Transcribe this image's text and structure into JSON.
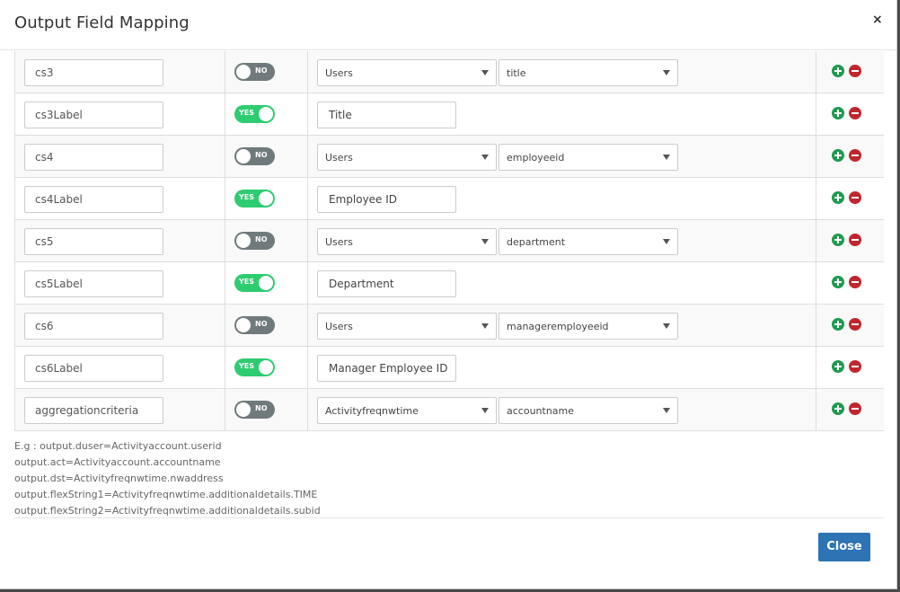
{
  "dialog": {
    "title": "Output Field Mapping",
    "close_icon": "×",
    "close_button_label": "Close"
  },
  "rows": [
    {
      "field": "cs3",
      "toggle": "NO",
      "toggle_on": false,
      "source": "Users",
      "attribute": "title"
    },
    {
      "field": "cs3Label",
      "toggle": "YES",
      "toggle_on": true,
      "label_value": "Title"
    },
    {
      "field": "cs4",
      "toggle": "NO",
      "toggle_on": false,
      "source": "Users",
      "attribute": "employeeid"
    },
    {
      "field": "cs4Label",
      "toggle": "YES",
      "toggle_on": true,
      "label_value": "Employee ID"
    },
    {
      "field": "cs5",
      "toggle": "NO",
      "toggle_on": false,
      "source": "Users",
      "attribute": "department"
    },
    {
      "field": "cs5Label",
      "toggle": "YES",
      "toggle_on": true,
      "label_value": "Department"
    },
    {
      "field": "cs6",
      "toggle": "NO",
      "toggle_on": false,
      "source": "Users",
      "attribute": "manageremployeeid"
    },
    {
      "field": "cs6Label",
      "toggle": "YES",
      "toggle_on": true,
      "label_value": "Manager Employee ID"
    },
    {
      "field": "aggregationcriteria",
      "toggle": "NO",
      "toggle_on": false,
      "source": "Activityfreqnwtime",
      "attribute": "accountname"
    }
  ],
  "example": {
    "lines": [
      "E.g : output.duser=Activityaccount.userid",
      "output.act=Activityaccount.accountname",
      "output.dst=Activityfreqnwtime.nwaddress",
      "output.flexString1=Activityfreqnwtime.additionaldetails.TIME",
      "output.flexString2=Activityfreqnwtime.additionaldetails.subid"
    ]
  },
  "colors": {
    "toggle_on": "#2ecc71",
    "toggle_off": "#707a7c",
    "add": "#1f9a4f",
    "remove": "#c0272d",
    "primary_button": "#2c74b3"
  },
  "icons": {
    "add": "plus-circle-icon",
    "remove": "minus-circle-icon",
    "dropdown": "caret-down-icon"
  }
}
